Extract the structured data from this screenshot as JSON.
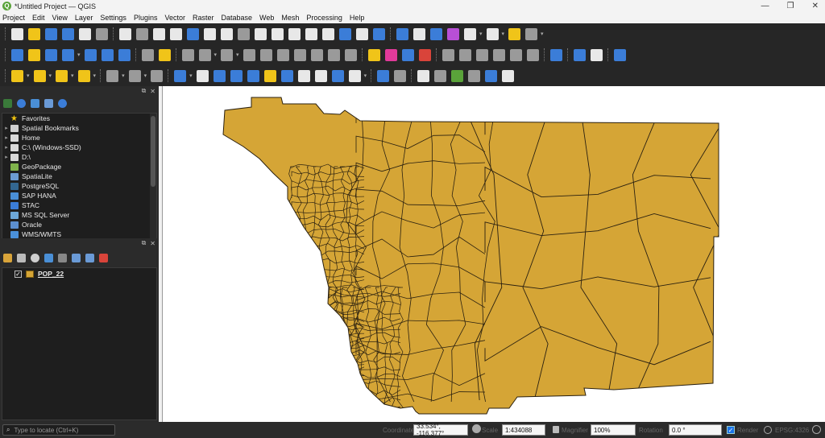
{
  "window": {
    "title": "*Untitled Project — QGIS"
  },
  "menus": [
    "Project",
    "Edit",
    "View",
    "Layer",
    "Settings",
    "Plugins",
    "Vector",
    "Raster",
    "Database",
    "Web",
    "Mesh",
    "Processing",
    "Help"
  ],
  "browser": {
    "items": [
      {
        "label": "Favorites",
        "icon": "star-icon",
        "color": "#f1c40f",
        "expand": ""
      },
      {
        "label": "Spatial Bookmarks",
        "icon": "bookmark-icon",
        "color": "#cfcfcf",
        "expand": "▸"
      },
      {
        "label": "Home",
        "icon": "folder-icon",
        "color": "#d9d9d9",
        "expand": "▸"
      },
      {
        "label": "C:\\ (Windows-SSD)",
        "icon": "folder-icon",
        "color": "#d9d9d9",
        "expand": "▸"
      },
      {
        "label": "D:\\",
        "icon": "folder-icon",
        "color": "#d9d9d9",
        "expand": "▸"
      },
      {
        "label": "GeoPackage",
        "icon": "geopackage-icon",
        "color": "#7fb24b",
        "expand": ""
      },
      {
        "label": "SpatiaLite",
        "icon": "spatialite-icon",
        "color": "#6c9bd1",
        "expand": ""
      },
      {
        "label": "PostgreSQL",
        "icon": "postgresql-icon",
        "color": "#336791",
        "expand": ""
      },
      {
        "label": "SAP HANA",
        "icon": "sap-hana-icon",
        "color": "#4a8fd6",
        "expand": ""
      },
      {
        "label": "STAC",
        "icon": "stac-icon",
        "color": "#3b7dd8",
        "expand": ""
      },
      {
        "label": "MS SQL Server",
        "icon": "mssql-icon",
        "color": "#6da8d8",
        "expand": ""
      },
      {
        "label": "Oracle",
        "icon": "oracle-icon",
        "color": "#5c8fd0",
        "expand": ""
      },
      {
        "label": "WMS/WMTS",
        "icon": "wms-icon",
        "color": "#4a90d9",
        "expand": ""
      }
    ]
  },
  "layers": [
    {
      "name": "POP_22",
      "visible": true,
      "fill": "#d5a536"
    }
  ],
  "map": {
    "fill_color": "#d5a536",
    "stroke_color": "#2a2010",
    "background": "#ffffff"
  },
  "status": {
    "locator_placeholder": "Type to locate (Ctrl+K)",
    "coordinate_label": "Coordinate",
    "coordinate": "33.534°, -116.377°",
    "scale_label": "Scale",
    "scale": "1:434088",
    "magnifier_label": "Magnifier",
    "magnifier": "100%",
    "rotation_label": "Rotation",
    "rotation": "0.0 °",
    "render_label": "Render",
    "crs": "EPSG:4326"
  },
  "toolbar_colors": {
    "blue": "#3b7dd8",
    "yellow": "#f0c419",
    "green": "#5aa33a",
    "red": "#d9443a",
    "gray": "#9a9a9a",
    "white": "#e8e8e8"
  }
}
